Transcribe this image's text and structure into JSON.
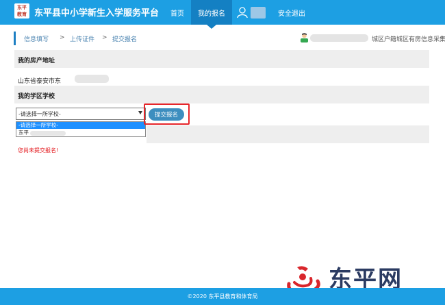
{
  "header": {
    "logo_text": "东平教育",
    "site_title": "东平县中小学新生入学服务平台",
    "nav": {
      "home": "首页",
      "my_signup": "我的报名",
      "logout": "安全退出"
    },
    "colors": {
      "header_bg": "#1d9fe3",
      "nav_active_bg": "#1480c3",
      "highlight_border": "#e6262b"
    }
  },
  "breadcrumb": {
    "steps": [
      "信息填写",
      "上传证件",
      "提交报名"
    ],
    "separator": ">",
    "region": "城区户籍城区有房信息采集"
  },
  "main": {
    "property_section": {
      "title": "我的房产地址",
      "address": "山东省泰安市东"
    },
    "school_section": {
      "title": "我的学区学校",
      "select": {
        "selected": "-请选择一所学校-",
        "options": [
          "-请选择一所学校-",
          "东平"
        ]
      },
      "submit_label": "提交报名"
    },
    "status_message": "您尚未提交报名!"
  },
  "footer": {
    "text": "©2020  东平县教育和体育局"
  },
  "watermark": {
    "text": "东平网"
  },
  "icons": {
    "user": "user-avatar-icon",
    "small_user": "user-avatar-icon",
    "dropdown_arrow": "chevron-down-icon"
  }
}
